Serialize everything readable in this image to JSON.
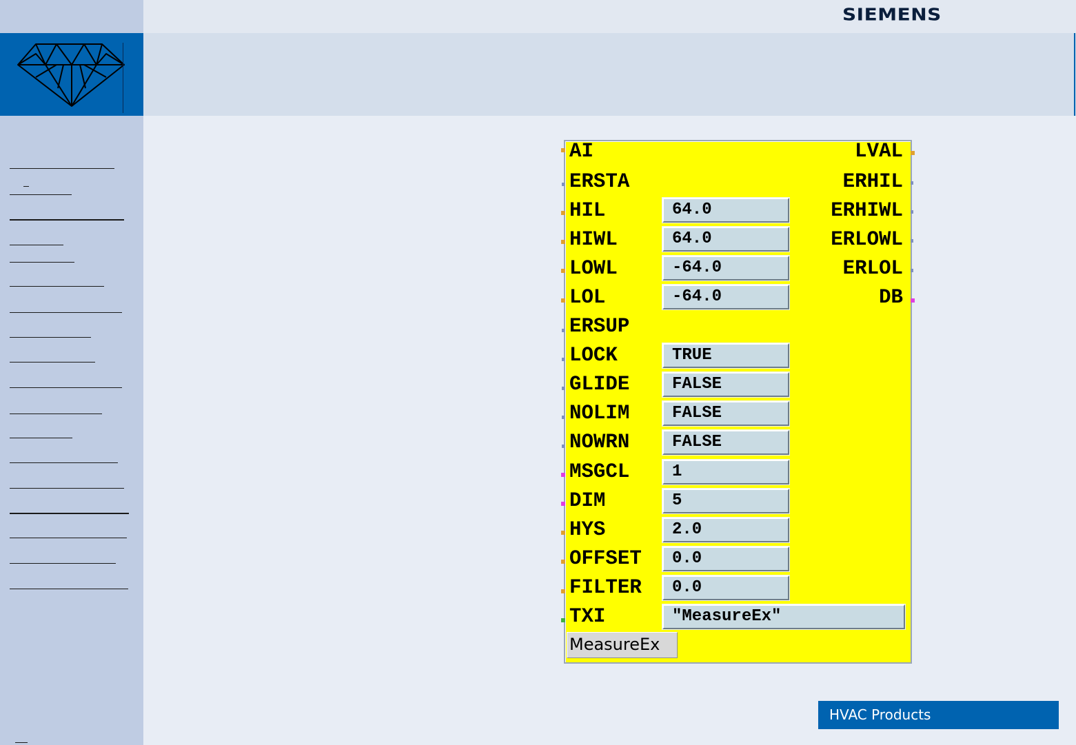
{
  "header": {
    "brand": "SIEMENS"
  },
  "block": {
    "name_tab": "MeasureEx",
    "inputs": [
      {
        "label": "AI",
        "value": null
      },
      {
        "label": "ERSTA",
        "value": null
      },
      {
        "label": "HIL",
        "value": "64.0"
      },
      {
        "label": "HIWL",
        "value": "64.0"
      },
      {
        "label": "LOWL",
        "value": "-64.0"
      },
      {
        "label": "LOL",
        "value": "-64.0"
      },
      {
        "label": "ERSUP",
        "value": null
      },
      {
        "label": "LOCK",
        "value": "TRUE"
      },
      {
        "label": "GLIDE",
        "value": "FALSE"
      },
      {
        "label": "NOLIM",
        "value": "FALSE"
      },
      {
        "label": "NOWRN",
        "value": "FALSE"
      },
      {
        "label": "MSGCL",
        "value": "1"
      },
      {
        "label": "DIM",
        "value": "5"
      },
      {
        "label": "HYS",
        "value": "2.0"
      },
      {
        "label": "OFFSET",
        "value": "0.0"
      },
      {
        "label": "FILTER",
        "value": "0.0"
      },
      {
        "label": "TXI",
        "value": "\"MeasureEx\""
      }
    ],
    "outputs": [
      "LVAL",
      "ERHIL",
      "ERHIWL",
      "ERLOWL",
      "ERLOL",
      "DB"
    ],
    "colors": {
      "block_fill": "#ffff00",
      "value_fill": "#c9dbe3",
      "pin_real": "#e0a030",
      "pin_bool": "#8090c0",
      "pin_int": "#e040e0",
      "pin_string": "#40b040"
    }
  },
  "footer": {
    "badge": "HVAC Products"
  },
  "theme": {
    "accent": "#0063b0",
    "sidebar": "#bfcce3",
    "header_band": "#d4deeb",
    "page": "#e8edf5"
  }
}
